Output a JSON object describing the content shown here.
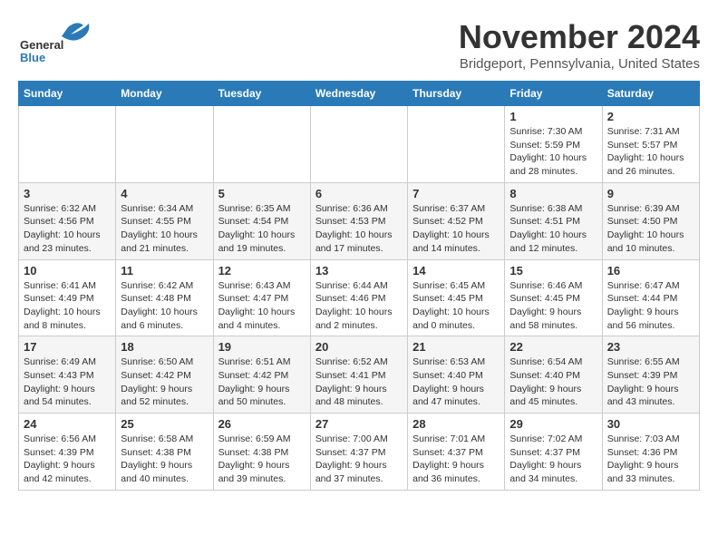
{
  "header": {
    "logo_line1": "General",
    "logo_line2": "Blue",
    "title": "November 2024",
    "subtitle": "Bridgeport, Pennsylvania, United States"
  },
  "columns": [
    "Sunday",
    "Monday",
    "Tuesday",
    "Wednesday",
    "Thursday",
    "Friday",
    "Saturday"
  ],
  "weeks": [
    {
      "days": [
        {
          "num": "",
          "info": ""
        },
        {
          "num": "",
          "info": ""
        },
        {
          "num": "",
          "info": ""
        },
        {
          "num": "",
          "info": ""
        },
        {
          "num": "",
          "info": ""
        },
        {
          "num": "1",
          "info": "Sunrise: 7:30 AM\nSunset: 5:59 PM\nDaylight: 10 hours and 28 minutes."
        },
        {
          "num": "2",
          "info": "Sunrise: 7:31 AM\nSunset: 5:57 PM\nDaylight: 10 hours and 26 minutes."
        }
      ]
    },
    {
      "days": [
        {
          "num": "3",
          "info": "Sunrise: 6:32 AM\nSunset: 4:56 PM\nDaylight: 10 hours and 23 minutes."
        },
        {
          "num": "4",
          "info": "Sunrise: 6:34 AM\nSunset: 4:55 PM\nDaylight: 10 hours and 21 minutes."
        },
        {
          "num": "5",
          "info": "Sunrise: 6:35 AM\nSunset: 4:54 PM\nDaylight: 10 hours and 19 minutes."
        },
        {
          "num": "6",
          "info": "Sunrise: 6:36 AM\nSunset: 4:53 PM\nDaylight: 10 hours and 17 minutes."
        },
        {
          "num": "7",
          "info": "Sunrise: 6:37 AM\nSunset: 4:52 PM\nDaylight: 10 hours and 14 minutes."
        },
        {
          "num": "8",
          "info": "Sunrise: 6:38 AM\nSunset: 4:51 PM\nDaylight: 10 hours and 12 minutes."
        },
        {
          "num": "9",
          "info": "Sunrise: 6:39 AM\nSunset: 4:50 PM\nDaylight: 10 hours and 10 minutes."
        }
      ]
    },
    {
      "days": [
        {
          "num": "10",
          "info": "Sunrise: 6:41 AM\nSunset: 4:49 PM\nDaylight: 10 hours and 8 minutes."
        },
        {
          "num": "11",
          "info": "Sunrise: 6:42 AM\nSunset: 4:48 PM\nDaylight: 10 hours and 6 minutes."
        },
        {
          "num": "12",
          "info": "Sunrise: 6:43 AM\nSunset: 4:47 PM\nDaylight: 10 hours and 4 minutes."
        },
        {
          "num": "13",
          "info": "Sunrise: 6:44 AM\nSunset: 4:46 PM\nDaylight: 10 hours and 2 minutes."
        },
        {
          "num": "14",
          "info": "Sunrise: 6:45 AM\nSunset: 4:45 PM\nDaylight: 10 hours and 0 minutes."
        },
        {
          "num": "15",
          "info": "Sunrise: 6:46 AM\nSunset: 4:45 PM\nDaylight: 9 hours and 58 minutes."
        },
        {
          "num": "16",
          "info": "Sunrise: 6:47 AM\nSunset: 4:44 PM\nDaylight: 9 hours and 56 minutes."
        }
      ]
    },
    {
      "days": [
        {
          "num": "17",
          "info": "Sunrise: 6:49 AM\nSunset: 4:43 PM\nDaylight: 9 hours and 54 minutes."
        },
        {
          "num": "18",
          "info": "Sunrise: 6:50 AM\nSunset: 4:42 PM\nDaylight: 9 hours and 52 minutes."
        },
        {
          "num": "19",
          "info": "Sunrise: 6:51 AM\nSunset: 4:42 PM\nDaylight: 9 hours and 50 minutes."
        },
        {
          "num": "20",
          "info": "Sunrise: 6:52 AM\nSunset: 4:41 PM\nDaylight: 9 hours and 48 minutes."
        },
        {
          "num": "21",
          "info": "Sunrise: 6:53 AM\nSunset: 4:40 PM\nDaylight: 9 hours and 47 minutes."
        },
        {
          "num": "22",
          "info": "Sunrise: 6:54 AM\nSunset: 4:40 PM\nDaylight: 9 hours and 45 minutes."
        },
        {
          "num": "23",
          "info": "Sunrise: 6:55 AM\nSunset: 4:39 PM\nDaylight: 9 hours and 43 minutes."
        }
      ]
    },
    {
      "days": [
        {
          "num": "24",
          "info": "Sunrise: 6:56 AM\nSunset: 4:39 PM\nDaylight: 9 hours and 42 minutes."
        },
        {
          "num": "25",
          "info": "Sunrise: 6:58 AM\nSunset: 4:38 PM\nDaylight: 9 hours and 40 minutes."
        },
        {
          "num": "26",
          "info": "Sunrise: 6:59 AM\nSunset: 4:38 PM\nDaylight: 9 hours and 39 minutes."
        },
        {
          "num": "27",
          "info": "Sunrise: 7:00 AM\nSunset: 4:37 PM\nDaylight: 9 hours and 37 minutes."
        },
        {
          "num": "28",
          "info": "Sunrise: 7:01 AM\nSunset: 4:37 PM\nDaylight: 9 hours and 36 minutes."
        },
        {
          "num": "29",
          "info": "Sunrise: 7:02 AM\nSunset: 4:37 PM\nDaylight: 9 hours and 34 minutes."
        },
        {
          "num": "30",
          "info": "Sunrise: 7:03 AM\nSunset: 4:36 PM\nDaylight: 9 hours and 33 minutes."
        }
      ]
    }
  ]
}
